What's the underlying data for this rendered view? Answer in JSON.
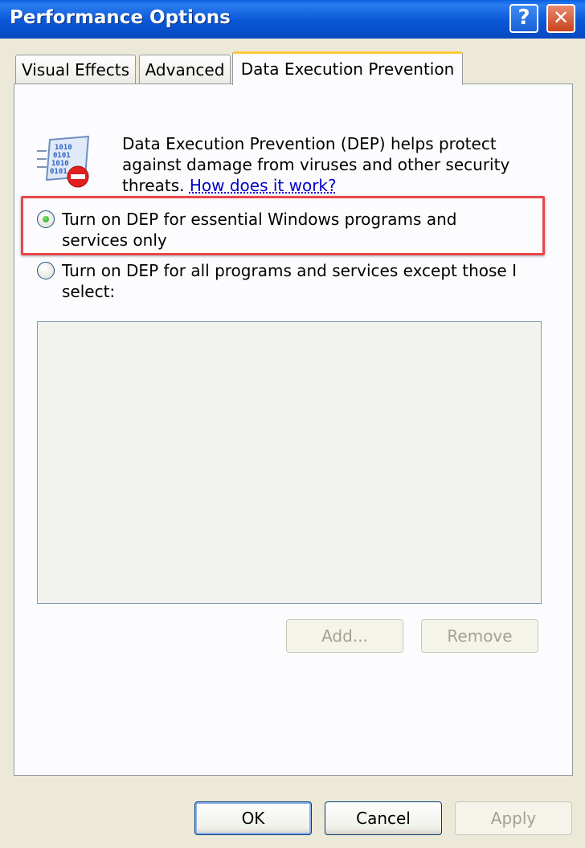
{
  "window": {
    "title": "Performance Options",
    "help_label": "?",
    "close_label": "✕"
  },
  "tabs": [
    {
      "label": "Visual Effects"
    },
    {
      "label": "Advanced"
    },
    {
      "label": "Data Execution Prevention"
    }
  ],
  "dep": {
    "description": "Data Execution Prevention (DEP) helps protect against damage from viruses and other security threats.",
    "link_text": "How does it work?",
    "icon": "dep-shield-icon",
    "options": [
      {
        "label": "Turn on DEP for essential Windows programs and services only",
        "selected": true
      },
      {
        "label": "Turn on DEP for all programs and services except those I select:",
        "selected": false
      }
    ],
    "add_label": "Add...",
    "remove_label": "Remove"
  },
  "footer": {
    "ok_label": "OK",
    "cancel_label": "Cancel",
    "apply_label": "Apply"
  },
  "colors": {
    "titlebar": "#0a57d6",
    "highlight": "#e8474a",
    "active_tab_accent": "#ffc83c"
  }
}
